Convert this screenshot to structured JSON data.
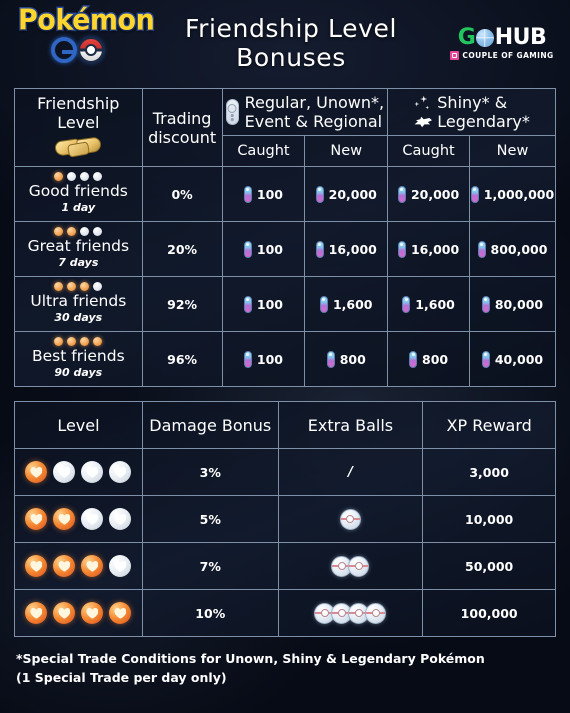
{
  "header": {
    "logo": {
      "wordmark": "Pokémon",
      "go_text": "GO"
    },
    "title_line1": "Friendship Level",
    "title_line2": "Bonuses",
    "gohub": {
      "g": "G",
      "hub": "HUB",
      "tagline": "COUPLE OF GAMING"
    }
  },
  "table1": {
    "headers": {
      "friendship_level": "Friendship\nLevel",
      "friendship_level_l1": "Friendship",
      "friendship_level_l2": "Level",
      "trading_discount_l1": "Trading",
      "trading_discount_l2": "discount",
      "regular_group_l1": "Regular, Unown*,",
      "regular_group_l2": "Event & Regional",
      "shiny_group_l1": "Shiny* &",
      "shiny_group_l2": "Legendary*",
      "caught": "Caught",
      "new": "New"
    },
    "rows": [
      {
        "name": "Good friends",
        "days": "1 day",
        "dots_on": 1,
        "dots_total": 4,
        "discount": "0%",
        "regular_caught": "100",
        "regular_new": "20,000",
        "shiny_caught": "20,000",
        "shiny_new": "1,000,000"
      },
      {
        "name": "Great friends",
        "days": "7 days",
        "dots_on": 2,
        "dots_total": 4,
        "discount": "20%",
        "regular_caught": "100",
        "regular_new": "16,000",
        "shiny_caught": "16,000",
        "shiny_new": "800,000"
      },
      {
        "name": "Ultra friends",
        "days": "30 days",
        "dots_on": 3,
        "dots_total": 4,
        "discount": "92%",
        "regular_caught": "100",
        "regular_new": "1,600",
        "shiny_caught": "1,600",
        "shiny_new": "80,000"
      },
      {
        "name": "Best friends",
        "days": "90 days",
        "dots_on": 4,
        "dots_total": 4,
        "discount": "96%",
        "regular_caught": "100",
        "regular_new": "800",
        "shiny_caught": "800",
        "shiny_new": "40,000"
      }
    ]
  },
  "table2": {
    "headers": {
      "level": "Level",
      "damage_bonus": "Damage Bonus",
      "extra_balls": "Extra Balls",
      "xp_reward": "XP Reward"
    },
    "rows": [
      {
        "hearts_on": 1,
        "hearts_total": 4,
        "damage": "3%",
        "balls": 0,
        "balls_text": "/",
        "xp": "3,000"
      },
      {
        "hearts_on": 2,
        "hearts_total": 4,
        "damage": "5%",
        "balls": 1,
        "balls_text": "",
        "xp": "10,000"
      },
      {
        "hearts_on": 3,
        "hearts_total": 4,
        "damage": "7%",
        "balls": 2,
        "balls_text": "",
        "xp": "50,000"
      },
      {
        "hearts_on": 4,
        "hearts_total": 4,
        "damage": "10%",
        "balls": 4,
        "balls_text": "",
        "xp": "100,000"
      }
    ]
  },
  "footer": {
    "line1": "*Special Trade Conditions for Unown, Shiny & Legendary Pokémon",
    "line2": "(1 Special Trade per day only)"
  },
  "colors": {
    "accent_gold": "#e8c269",
    "dot_active": "#f2a24f",
    "heart_active": "#f58a33",
    "gohub_green": "#23c55e",
    "pokemon_yellow": "#ffd52e",
    "pokemon_blue": "#2a4d9b"
  }
}
